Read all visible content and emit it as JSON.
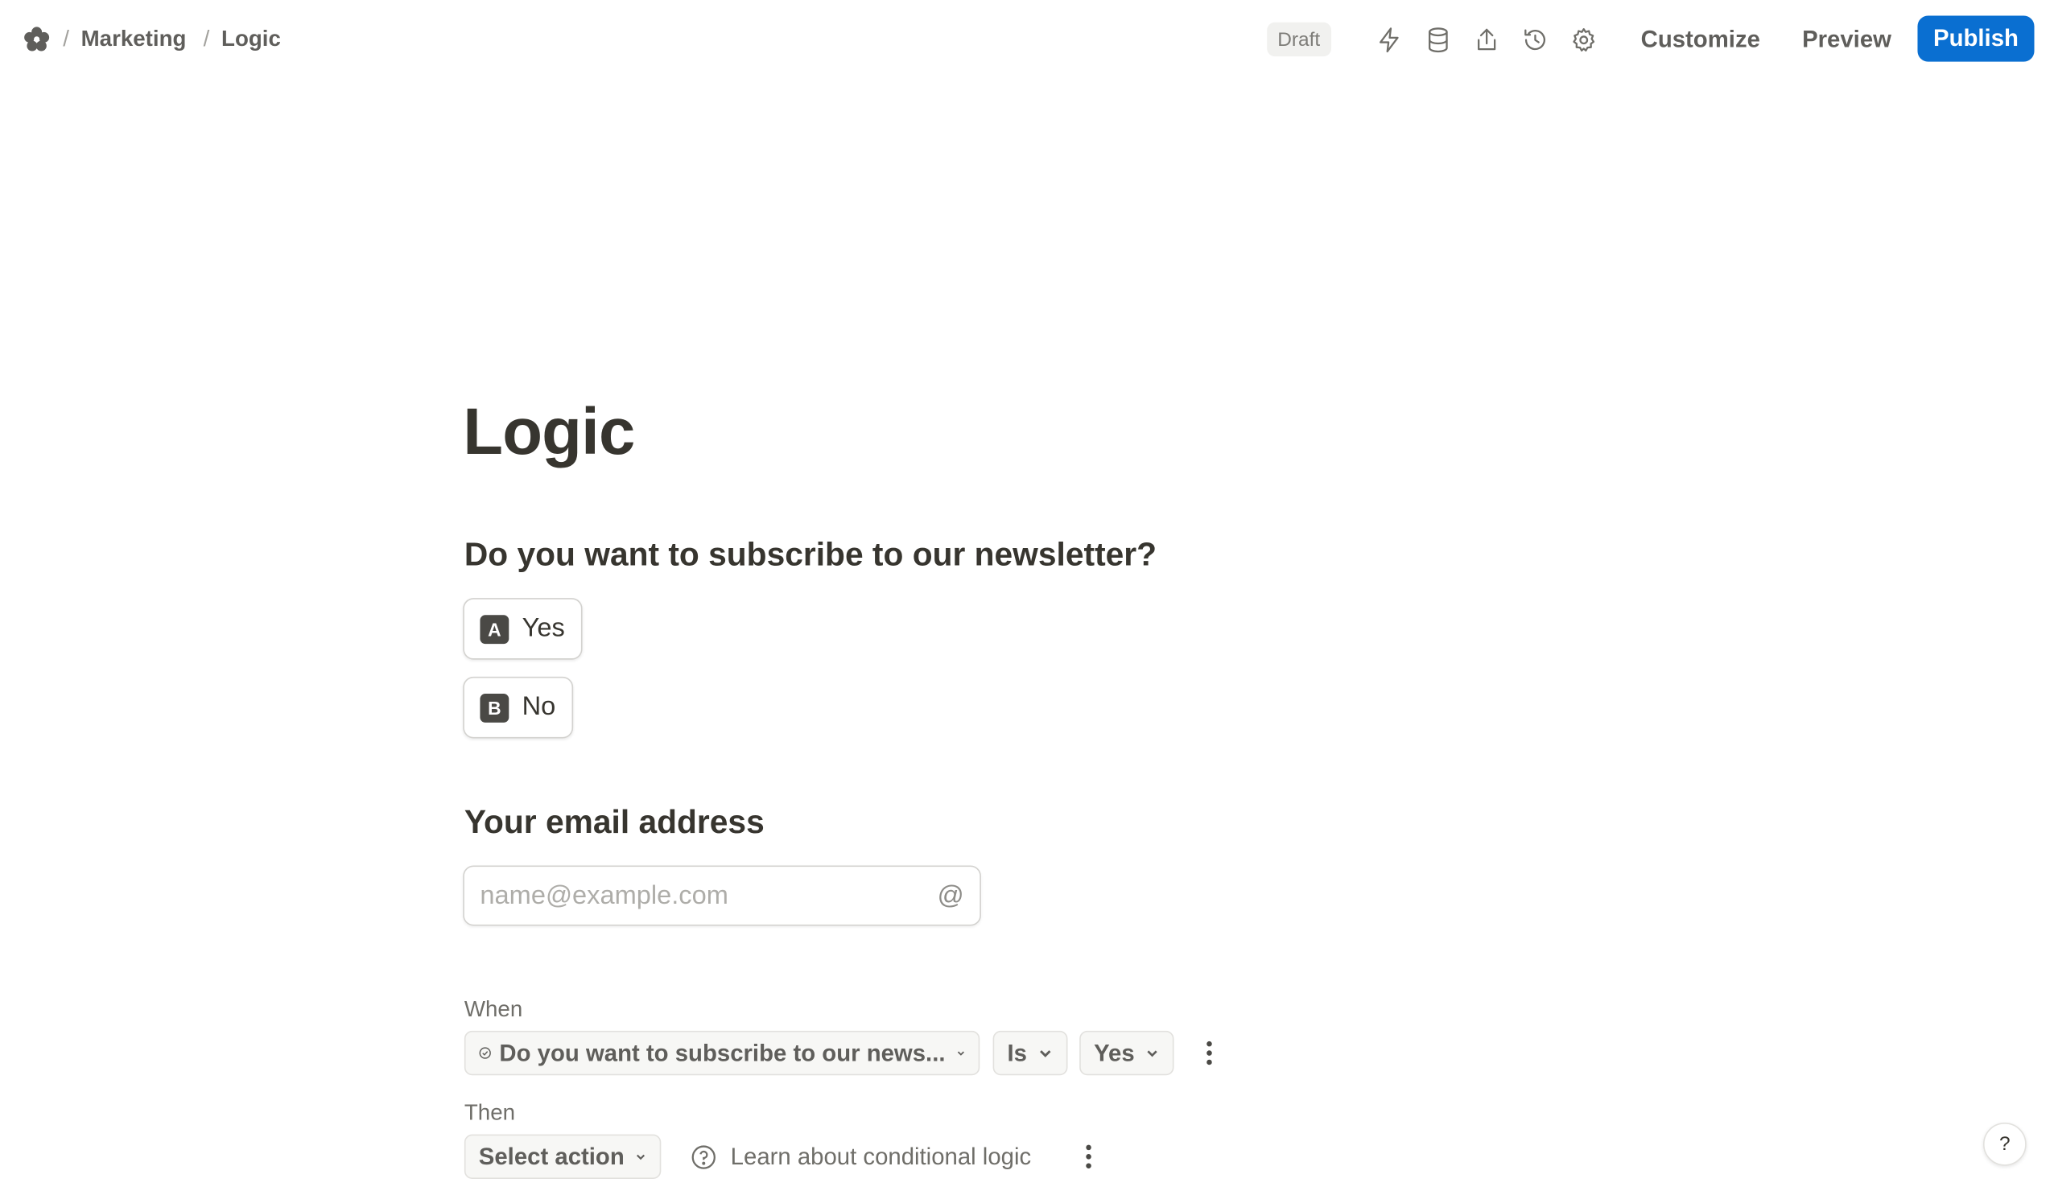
{
  "breadcrumb": {
    "workspace_icon": "flower-logo-icon",
    "separator": "/",
    "items": [
      "Marketing",
      "Logic"
    ]
  },
  "toolbar": {
    "status": "Draft",
    "icons": [
      "lightning-icon",
      "database-icon",
      "share-icon",
      "history-icon",
      "gear-icon"
    ],
    "customize_label": "Customize",
    "preview_label": "Preview",
    "publish_label": "Publish",
    "publish_color": "#0a6fd1"
  },
  "form": {
    "title": "Logic",
    "questions": [
      {
        "title": "Do you want to subscribe to our newsletter?",
        "options": [
          {
            "key": "A",
            "label": "Yes"
          },
          {
            "key": "B",
            "label": "No"
          }
        ]
      },
      {
        "title": "Your email address",
        "placeholder": "name@example.com",
        "value": "",
        "icon": "@"
      }
    ]
  },
  "logic": {
    "when_label": "When",
    "condition_field": "Do you want to subscribe to our news...",
    "condition_operator": "Is",
    "condition_value": "Yes",
    "then_label": "Then",
    "action_placeholder": "Select action",
    "learn_link": "Learn about conditional logic"
  },
  "help": {
    "label": "?"
  }
}
